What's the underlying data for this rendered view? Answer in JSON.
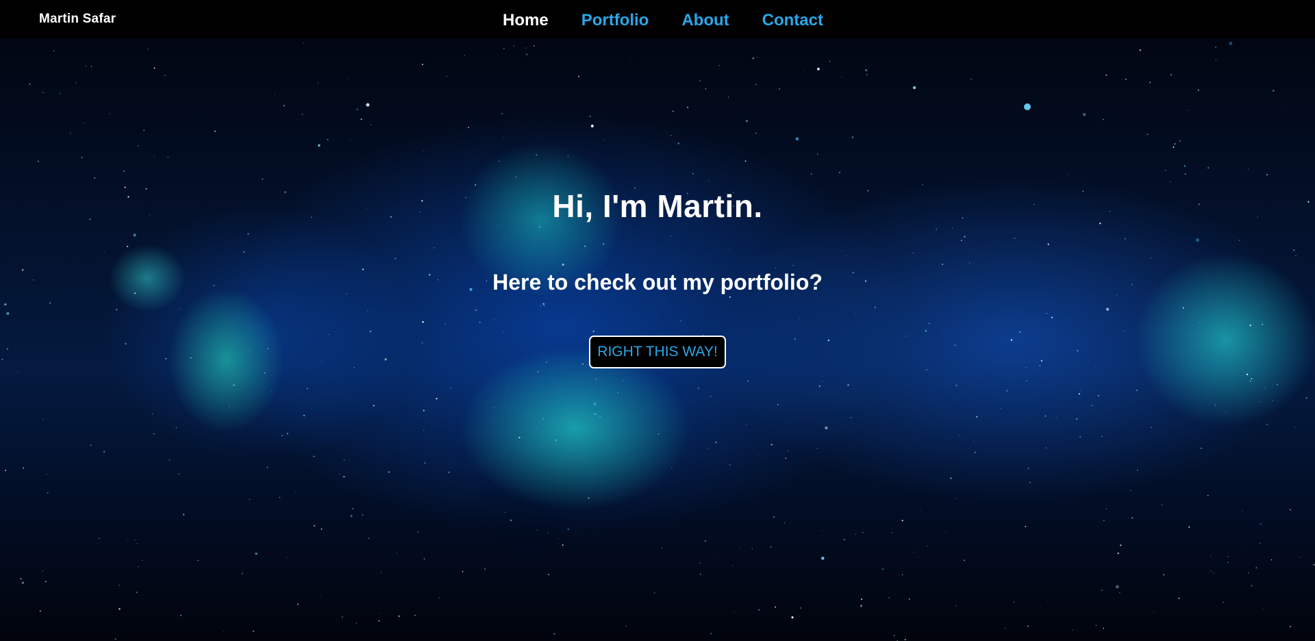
{
  "navbar": {
    "brand": "Martin Safar",
    "links": [
      {
        "label": "Home",
        "active": true
      },
      {
        "label": "Portfolio",
        "active": false
      },
      {
        "label": "About",
        "active": false
      },
      {
        "label": "Contact",
        "active": false
      }
    ]
  },
  "hero": {
    "title": "Hi, I'm Martin.",
    "subtitle": "Here to check out my portfolio?",
    "cta_label": "RIGHT THIS WAY!"
  },
  "colors": {
    "nav_background": "#000000",
    "active_link": "#ffffff",
    "link": "#2aa7ea",
    "button_background": "#000000",
    "button_border": "#ffffff",
    "button_text": "#2aa7ea"
  }
}
